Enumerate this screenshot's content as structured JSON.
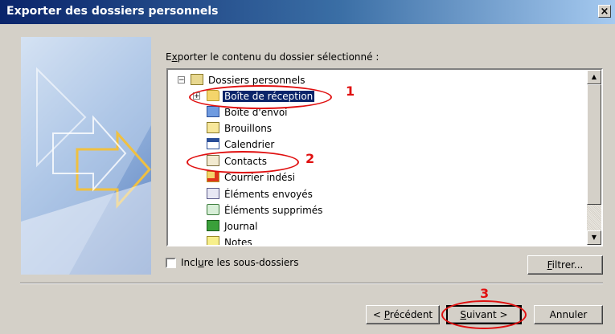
{
  "window": {
    "title": "Exporter des dossiers personnels",
    "close_glyph": "×"
  },
  "prompt": {
    "before": "E",
    "accel": "x",
    "after": "porter le contenu du dossier sélectionné :"
  },
  "tree": {
    "root": {
      "label": "Dossiers personnels",
      "icon": "personal-folders-icon",
      "expander": "⊟"
    },
    "items": [
      {
        "label": "Boîte de réception",
        "icon": "inbox-folder-icon",
        "selected": true,
        "expander": "+"
      },
      {
        "label": "Boîte d'envoi",
        "icon": "outbox-icon"
      },
      {
        "label": "Brouillons",
        "icon": "drafts-icon"
      },
      {
        "label": "Calendrier",
        "icon": "calendar-icon"
      },
      {
        "label": "Contacts",
        "icon": "contacts-icon"
      },
      {
        "label": "Courrier indési",
        "icon": "junk-mail-icon"
      },
      {
        "label": "Éléments envoyés",
        "icon": "sent-items-icon"
      },
      {
        "label": "Éléments supprimés",
        "icon": "deleted-items-icon"
      },
      {
        "label": "Journal",
        "icon": "journal-icon"
      },
      {
        "label": "Notes",
        "icon": "notes-icon"
      }
    ],
    "scroll_up": "▲",
    "scroll_down": "▼"
  },
  "include_subfolders": {
    "before": "Incl",
    "accel": "u",
    "after": "re les sous-dossiers",
    "checked": false
  },
  "buttons": {
    "filter": {
      "accel": "F",
      "after": "iltrer..."
    },
    "back": {
      "before": "< ",
      "accel": "P",
      "after": "récédent"
    },
    "next": {
      "accel": "S",
      "after": "uivant >"
    },
    "cancel": "Annuler"
  },
  "annotations": [
    "1",
    "2",
    "3"
  ],
  "colors": {
    "title_start": "#0a246a",
    "title_end": "#a6caf0",
    "selection": "#0a246a",
    "annotation": "#e01010"
  }
}
